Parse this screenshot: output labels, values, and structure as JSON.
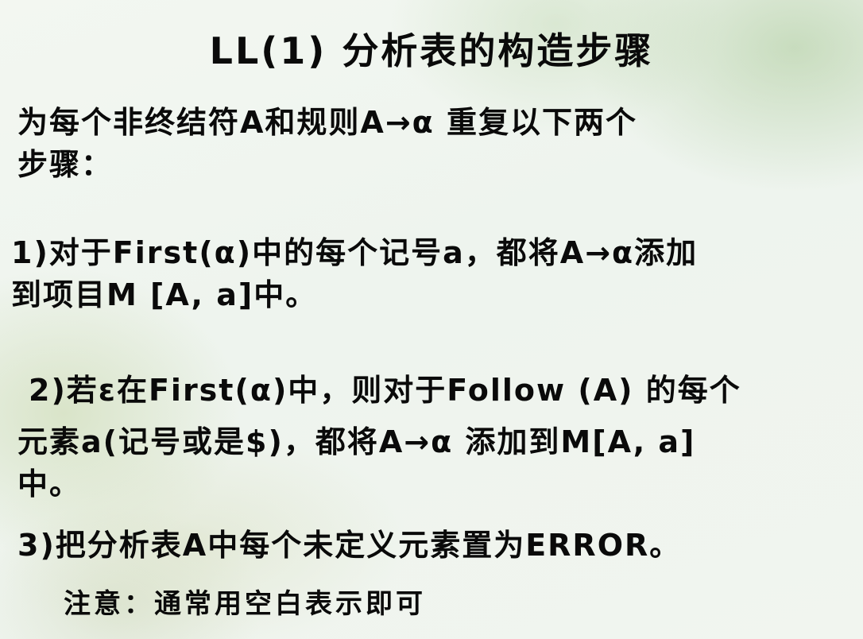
{
  "slide": {
    "title": "LL(1) 分析表的构造步骤",
    "intro": "为每个非终结符A和规则A→α 重复以下两个\n步骤：",
    "step1": "1)对于First(α)中的每个记号a，都将A→α添加\n到项目M [A, a]中。",
    "step2_line1": "2)若ε在First(α)中，则对于Follow (A) 的每个",
    "step2_rest": "元素a(记号或是$)，都将A→α 添加到M[A, a]\n中。",
    "step3": "3)把分析表A中每个未定义元素置为ERROR。",
    "note": "注意：通常用空白表示即可"
  }
}
